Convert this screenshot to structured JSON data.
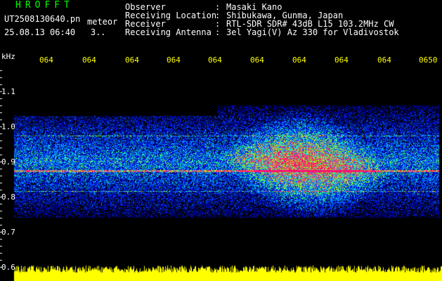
{
  "header": {
    "app_title": "HROFFT",
    "file_name": "UT2508130640.pn",
    "file_tag": "meteor",
    "date_time": "25.08.13 06:40",
    "count": "3..",
    "meta": [
      {
        "key": "Observer",
        "value": "Masaki Kano"
      },
      {
        "key": "Receiving Location",
        "value": "Shibukawa, Gunma, Japan"
      },
      {
        "key": "Receiver",
        "value": "RTL-SDR SDR# 43dB L15 103.2MHz CW"
      },
      {
        "key": "Receiving Antenna",
        "value": "3el Yagi(V) Az 330 for Vladivostok"
      }
    ]
  },
  "axis": {
    "unit": "kHz",
    "y_ticks": [
      "1.1",
      "1.0",
      "0.9",
      "0.8",
      "0.7",
      "0.6"
    ],
    "x_ticks": [
      "064",
      "064",
      "064",
      "064",
      "064",
      "064",
      "064",
      "064",
      "064",
      "0650"
    ]
  },
  "colors": {
    "background": "#000000",
    "axis_text": "#ffffff",
    "time_labels": "#ffff00",
    "title_green": "#00ff00",
    "noise_floor": "#ffff00"
  }
}
